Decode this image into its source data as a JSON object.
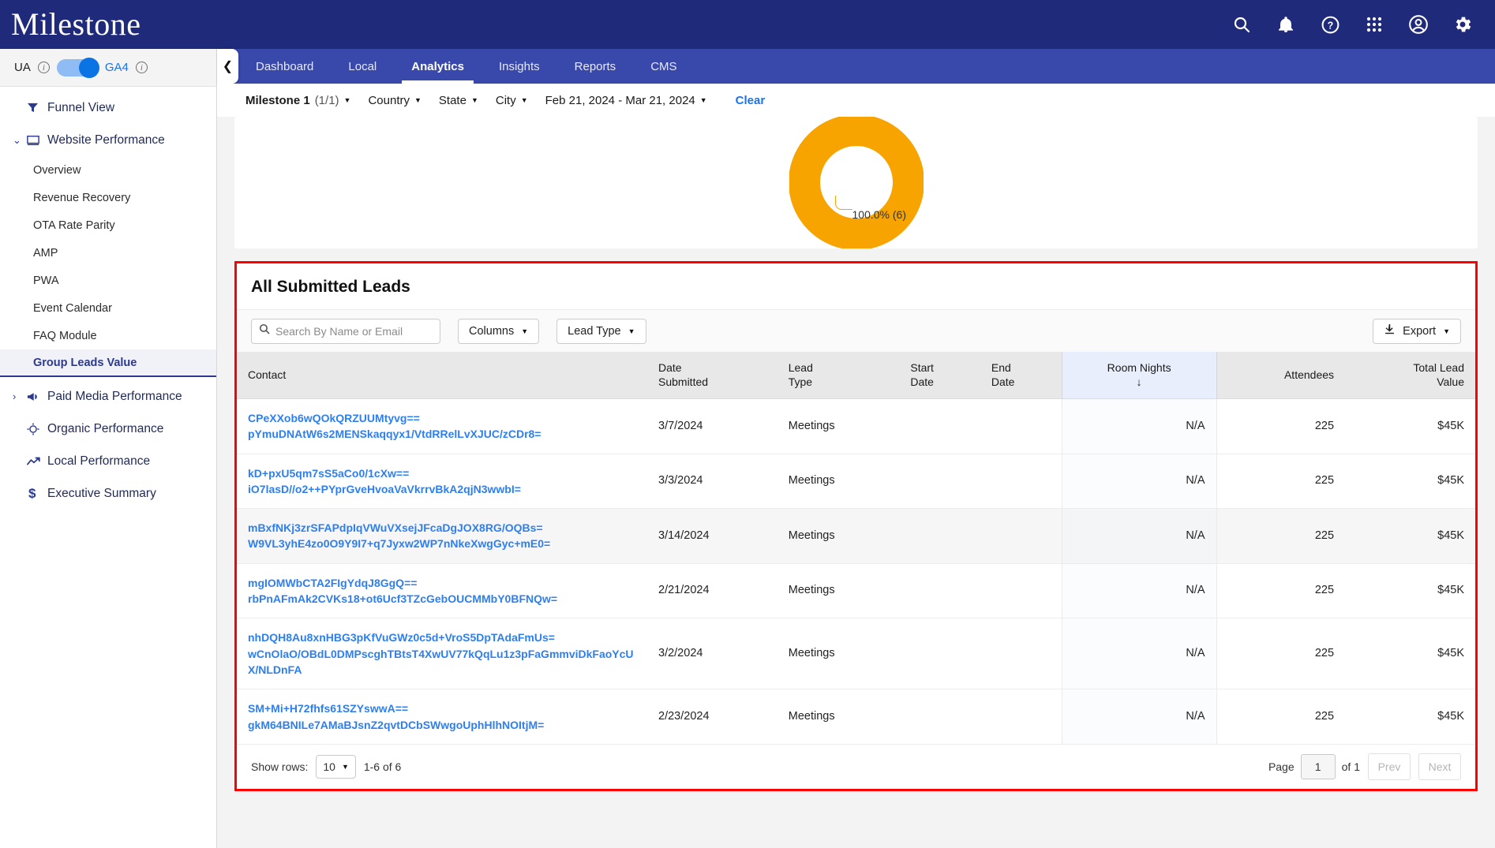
{
  "brand": {
    "name": "Milestone"
  },
  "header_icons": [
    {
      "name": "search-icon"
    },
    {
      "name": "notifications-bell-icon"
    },
    {
      "name": "help-question-icon"
    },
    {
      "name": "apps-grid-icon"
    },
    {
      "name": "account-circle-icon"
    },
    {
      "name": "settings-gear-icon"
    }
  ],
  "sidebar": {
    "toggle": {
      "left_label": "UA",
      "right_label": "GA4",
      "state": "GA4"
    },
    "items": [
      {
        "label": "Funnel View",
        "icon": "funnel-icon",
        "type": "top",
        "caret": ""
      },
      {
        "label": "Website Performance",
        "icon": "monitor-icon",
        "type": "top",
        "caret": "expanded"
      },
      {
        "label": "Overview",
        "type": "sub"
      },
      {
        "label": "Revenue Recovery",
        "type": "sub"
      },
      {
        "label": "OTA Rate Parity",
        "type": "sub"
      },
      {
        "label": "AMP",
        "type": "sub"
      },
      {
        "label": "PWA",
        "type": "sub"
      },
      {
        "label": "Event Calendar",
        "type": "sub"
      },
      {
        "label": "FAQ Module",
        "type": "sub"
      },
      {
        "label": "Group Leads Value",
        "type": "sub",
        "active": true
      },
      {
        "label": "Paid Media Performance",
        "icon": "megaphone-icon",
        "type": "top",
        "caret": "collapsed"
      },
      {
        "label": "Organic Performance",
        "icon": "target-icon",
        "type": "top-nocaret"
      },
      {
        "label": "Local Performance",
        "icon": "trend-line-icon",
        "type": "top-nocaret"
      },
      {
        "label": "Executive Summary",
        "icon": "dollar-icon",
        "type": "top-nocaret"
      }
    ]
  },
  "tabs": [
    {
      "label": "Dashboard",
      "active": false
    },
    {
      "label": "Local",
      "active": false
    },
    {
      "label": "Analytics",
      "active": true
    },
    {
      "label": "Insights",
      "active": false
    },
    {
      "label": "Reports",
      "active": false
    },
    {
      "label": "CMS",
      "active": false
    }
  ],
  "collapse_toggle": {
    "icon": "chevron-left-icon"
  },
  "filters": [
    {
      "label": "Milestone 1",
      "sub": "(1/1)",
      "bold": true
    },
    {
      "label": "Country",
      "sub": "",
      "bold": false
    },
    {
      "label": "State",
      "sub": "",
      "bold": false
    },
    {
      "label": "City",
      "sub": "",
      "bold": false
    },
    {
      "label": "Feb 21, 2024 - Mar 21, 2024",
      "sub": "",
      "bold": false
    }
  ],
  "clear_label": "Clear",
  "donut": {
    "percent_label": "100.0% (6)",
    "color": "#f7a400",
    "value": 100.0,
    "count": 6
  },
  "leads": {
    "title": "All Submitted Leads",
    "search_placeholder": "Search By Name or Email",
    "search_value": "",
    "columns_button": "Columns",
    "lead_type_button": "Lead Type",
    "export_button": "Export",
    "headers": {
      "contact": "Contact",
      "date_submitted": "Date Submitted",
      "lead_type": "Lead Type",
      "start_date": "Start Date",
      "end_date": "End Date",
      "room_nights": "Room Nights",
      "attendees": "Attendees",
      "total_lead_value": "Total Lead Value",
      "sort_arrow": "↓"
    },
    "rows": [
      {
        "contact_line1": "CPeXXob6wQOkQRZUUMtyvg==",
        "contact_line2": "pYmuDNAtW6s2MENSkaqqyx1/VtdRRelLvXJUC/zCDr8=",
        "date_submitted": "3/7/2024",
        "lead_type": "Meetings",
        "start_date": "",
        "end_date": "",
        "room_nights": "N/A",
        "attendees": "225",
        "total_lead_value": "$45K"
      },
      {
        "contact_line1": "kD+pxU5qm7sS5aCo0/1cXw==",
        "contact_line2": "iO7lasD//o2++PYprGveHvoaVaVkrrvBkA2qjN3wwbI=",
        "date_submitted": "3/3/2024",
        "lead_type": "Meetings",
        "start_date": "",
        "end_date": "",
        "room_nights": "N/A",
        "attendees": "225",
        "total_lead_value": "$45K"
      },
      {
        "contact_line1": "mBxfNKj3zrSFAPdpIqVWuVXsejJFcaDgJOX8RG/OQBs=",
        "contact_line2": "W9VL3yhE4zo0O9Y9I7+q7Jyxw2WP7nNkeXwgGyc+mE0=",
        "date_submitted": "3/14/2024",
        "lead_type": "Meetings",
        "start_date": "",
        "end_date": "",
        "room_nights": "N/A",
        "attendees": "225",
        "total_lead_value": "$45K"
      },
      {
        "contact_line1": "mgIOMWbCTA2FIgYdqJ8GgQ==",
        "contact_line2": "rbPnAFmAk2CVKs18+ot6Ucf3TZcGebOUCMMbY0BFNQw=",
        "date_submitted": "2/21/2024",
        "lead_type": "Meetings",
        "start_date": "",
        "end_date": "",
        "room_nights": "N/A",
        "attendees": "225",
        "total_lead_value": "$45K"
      },
      {
        "contact_line1": "nhDQH8Au8xnHBG3pKfVuGWz0c5d+VroS5DpTAdaFmUs=",
        "contact_line2": "wCnOlaO/OBdL0DMPscghTBtsT4XwUV77kQqLu1z3pFaGmmviDkFaoYcUX/NLDnFA",
        "date_submitted": "3/2/2024",
        "lead_type": "Meetings",
        "start_date": "",
        "end_date": "",
        "room_nights": "N/A",
        "attendees": "225",
        "total_lead_value": "$45K"
      },
      {
        "contact_line1": "SM+Mi+H72fhfs61SZYswwA==",
        "contact_line2": "gkM64BNILe7AMaBJsnZ2qvtDCbSWwgoUphHlhNOItjM=",
        "date_submitted": "2/23/2024",
        "lead_type": "Meetings",
        "start_date": "",
        "end_date": "",
        "room_nights": "N/A",
        "attendees": "225",
        "total_lead_value": "$45K"
      }
    ],
    "footer": {
      "show_rows_label": "Show rows:",
      "rows_per_page": "10",
      "range_label": "1-6 of 6",
      "page_label": "Page",
      "page_value": "1",
      "of_label": "of 1",
      "prev_label": "Prev",
      "next_label": "Next"
    }
  },
  "colors": {
    "brand_navy": "#1f2a7a",
    "tab_blue": "#3949ab",
    "link_blue": "#2d7ff0",
    "accent_orange": "#f7a400",
    "highlight_red": "#ff0000"
  }
}
